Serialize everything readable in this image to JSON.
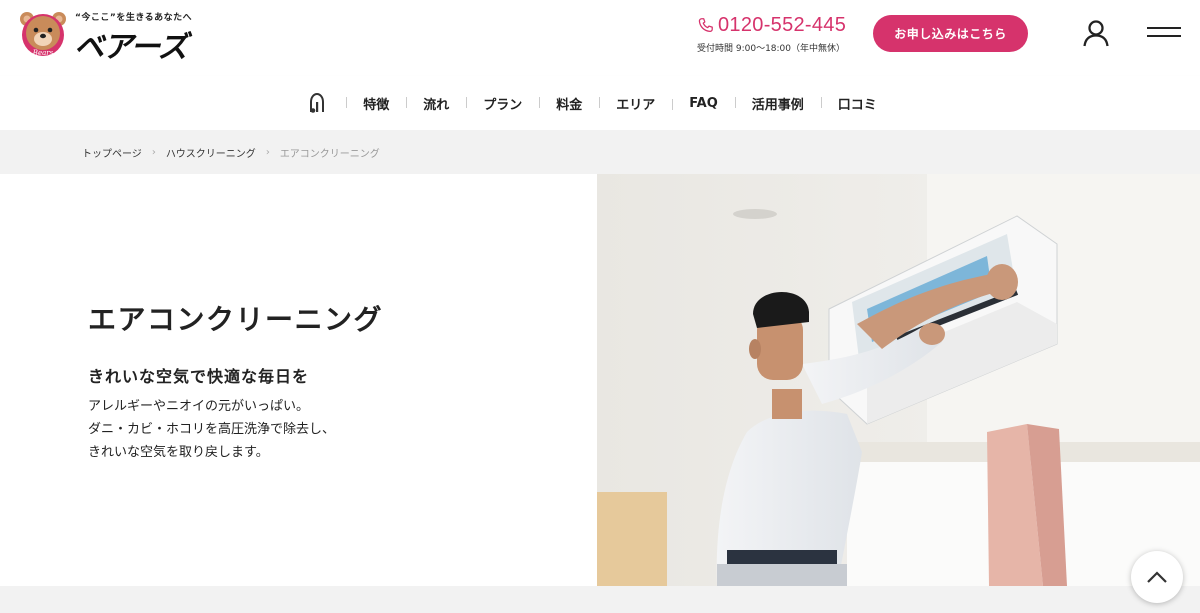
{
  "header": {
    "logo_tagline": "“今ここ”を生きるあなたへ",
    "logo_text": "ベアーズ",
    "logo_badge": "Bears",
    "phone_number": "0120-552-445",
    "phone_hours": "受付時間 9:00〜18:00（年中無休）",
    "apply_label": "お申し込みはこちら",
    "user_icon": "user-icon",
    "menu_icon": "hamburger-menu-icon",
    "accent_color": "#d6336c"
  },
  "nav": {
    "home_icon": "home-icon",
    "items": [
      {
        "label": "特徴"
      },
      {
        "label": "流れ"
      },
      {
        "label": "プラン"
      },
      {
        "label": "料金"
      },
      {
        "label": "エリア"
      },
      {
        "label": "FAQ"
      },
      {
        "label": "活用事例"
      },
      {
        "label": "口コミ"
      }
    ]
  },
  "breadcrumb": {
    "items": [
      "トップページ",
      "ハウスクリーニング"
    ],
    "current": "エアコンクリーニング"
  },
  "hero": {
    "title": "エアコンクリーニング",
    "subtitle": "きれいな空気で快適な毎日を",
    "description": [
      "アレルギーやニオイの元がいっぱい。",
      "ダニ・カビ・ホコリを高圧洗浄で除去し、",
      "きれいな空気を取り戻します。"
    ]
  },
  "scroll_top_icon": "chevron-up-icon"
}
